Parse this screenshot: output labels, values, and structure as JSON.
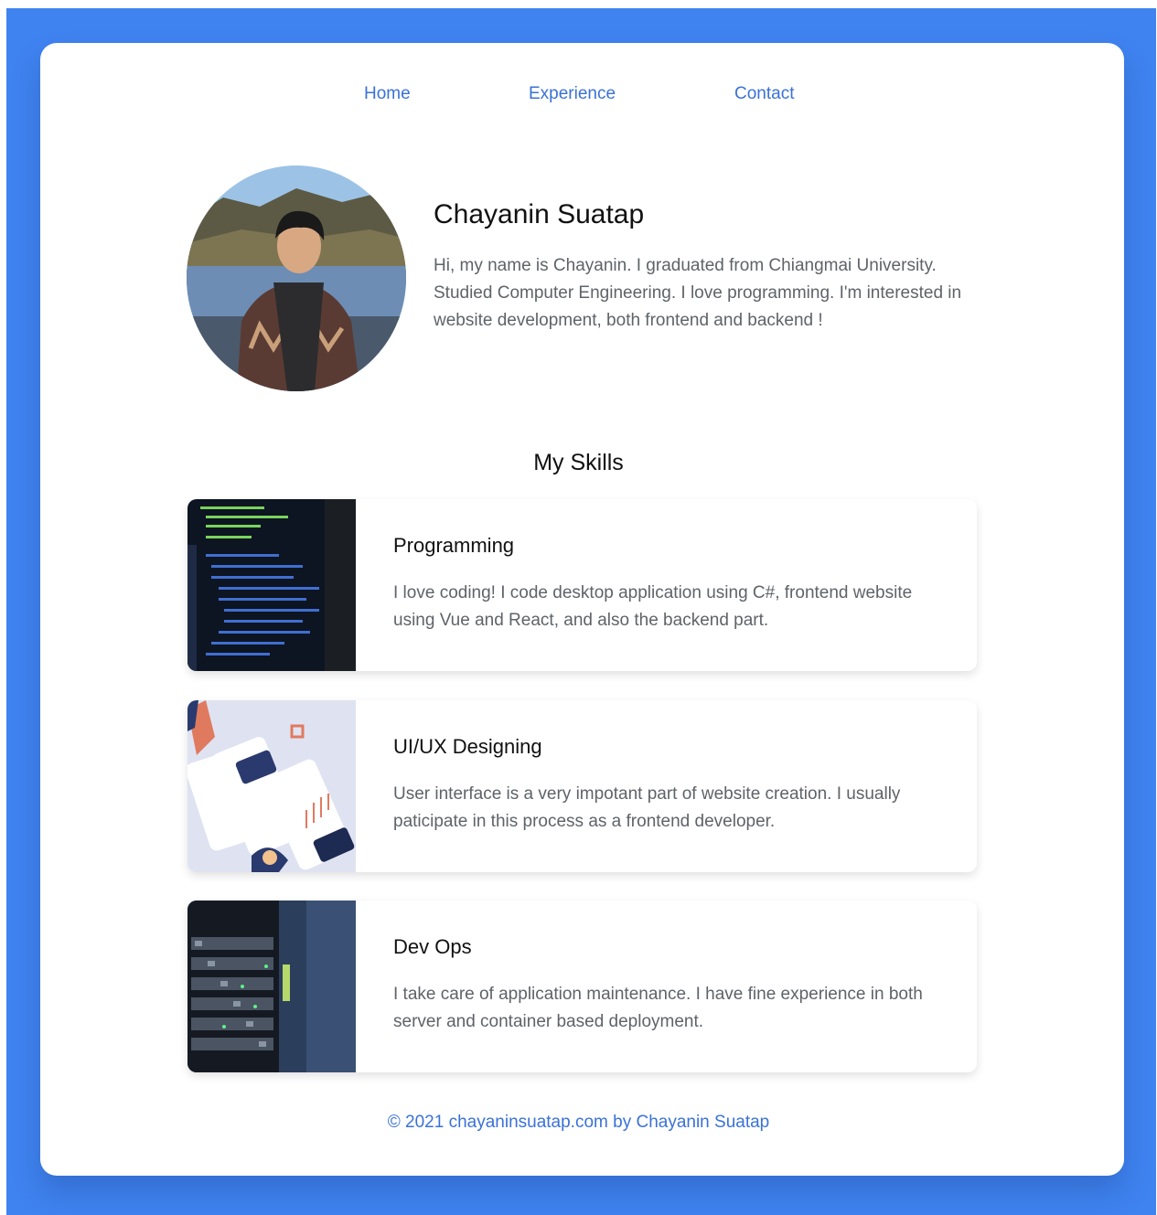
{
  "nav": {
    "items": [
      {
        "label": "Home"
      },
      {
        "label": "Experience"
      },
      {
        "label": "Contact"
      }
    ]
  },
  "profile": {
    "name": "Chayanin Suatap",
    "bio": "Hi, my name is Chayanin. I graduated from Chiangmai University. Studied Computer Engineering. I love programming. I'm interested in website development, both frontend and backend !"
  },
  "skills": {
    "title": "My Skills",
    "items": [
      {
        "title": "Programming",
        "description": "I love coding! I code desktop application using C#, frontend website using Vue and React, and also the backend part."
      },
      {
        "title": "UI/UX Designing",
        "description": "User interface is a very impotant part of website creation. I usually paticipate in this process as a frontend developer."
      },
      {
        "title": "Dev Ops",
        "description": "I take care of application maintenance. I have fine experience in both server and container based deployment."
      }
    ]
  },
  "footer": {
    "text": "© 2021 chayaninsuatap.com by Chayanin Suatap"
  },
  "colors": {
    "background": "#3f83f0",
    "link": "#3a72d8",
    "text": "#111111",
    "muted": "#5f6368"
  }
}
